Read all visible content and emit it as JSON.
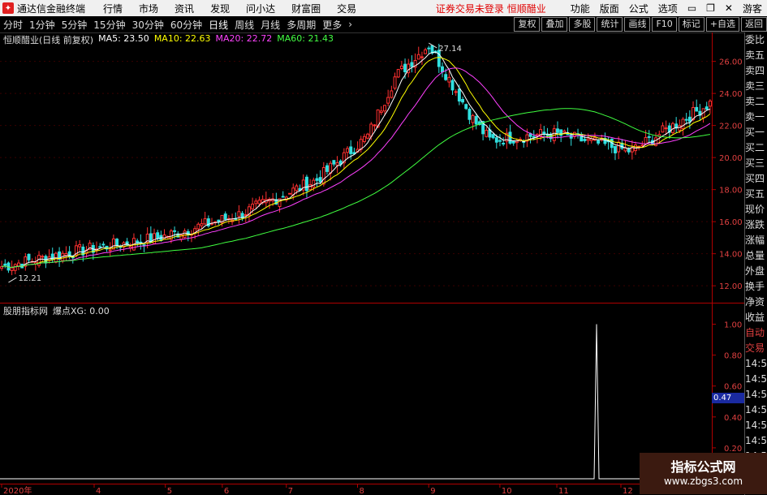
{
  "menubar": {
    "app_title": "通达信金融终端",
    "items": [
      "行情",
      "市场",
      "资讯",
      "发现",
      "问小达",
      "财富圈",
      "交易"
    ],
    "alert": "证券交易未登录  恒顺醋业",
    "right_items": [
      "功能",
      "版面",
      "公式",
      "选项"
    ],
    "user": "游客"
  },
  "toolbar": {
    "periods": [
      "分时",
      "1分钟",
      "5分钟",
      "15分钟",
      "30分钟",
      "60分钟",
      "日线",
      "周线",
      "月线",
      "多周期",
      "更多"
    ],
    "active": "日线",
    "right_buttons": [
      "复权",
      "叠加",
      "多股",
      "统计",
      "画线",
      "F10",
      "标记",
      "+自选",
      "返回"
    ]
  },
  "legend": {
    "title": "恒顺醋业(日线 前复权)",
    "ma5": "MA5: 23.50",
    "ma10": "MA10: 22.63",
    "ma20": "MA20: 22.72",
    "ma60": "MA60: 21.43",
    "colors": {
      "ma5": "#ffffff",
      "ma10": "#ffff00",
      "ma20": "#ff40ff",
      "ma60": "#40ff40"
    }
  },
  "indicator": {
    "name": "股朋指标网",
    "label": "爆点XG: 0.00",
    "axis_ticks": [
      "1.00",
      "0.80",
      "0.60",
      "0.40",
      "0.20"
    ],
    "current": "0.47"
  },
  "annotations": {
    "high": "27.14",
    "low": "12.21"
  },
  "price_axis": [
    "26.00",
    "24.00",
    "22.00",
    "20.00",
    "18.00",
    "16.00",
    "14.00",
    "12.00"
  ],
  "time_axis": [
    "2020年",
    "4",
    "5",
    "6",
    "7",
    "8",
    "9",
    "10",
    "11",
    "12"
  ],
  "side_panel": [
    "委比",
    "卖五",
    "卖四",
    "卖三",
    "卖二",
    "卖一",
    "买一",
    "买二",
    "买三",
    "买四",
    "买五",
    "现价",
    "涨跌",
    "涨幅",
    "总量",
    "外盘",
    "换手",
    "净资",
    "收益",
    "自动",
    "交易",
    "14:56",
    "14:56",
    "14:56",
    "14:56",
    "14:56",
    "14:56",
    "14:56",
    "14:56",
    "14:56"
  ],
  "watermark": {
    "line1": "指标公式网",
    "line2": "www.zbgs3.com"
  },
  "chart_data": {
    "type": "candlestick",
    "title": "恒顺醋业(日线 前复权)",
    "ylim": [
      11.3,
      27.5
    ],
    "x": [
      "2020-03",
      "2020-04",
      "2020-05",
      "2020-06",
      "2020-07",
      "2020-08",
      "2020-09",
      "2020-10",
      "2020-11",
      "2020-12"
    ],
    "close": [
      13.2,
      14.2,
      15.0,
      16.4,
      18.6,
      22.8,
      21.0,
      21.5,
      20.4,
      23.4
    ],
    "high_point": 27.14,
    "low_point": 12.21,
    "indicator_spike": {
      "x": "2020-11",
      "value": 1.0
    }
  }
}
